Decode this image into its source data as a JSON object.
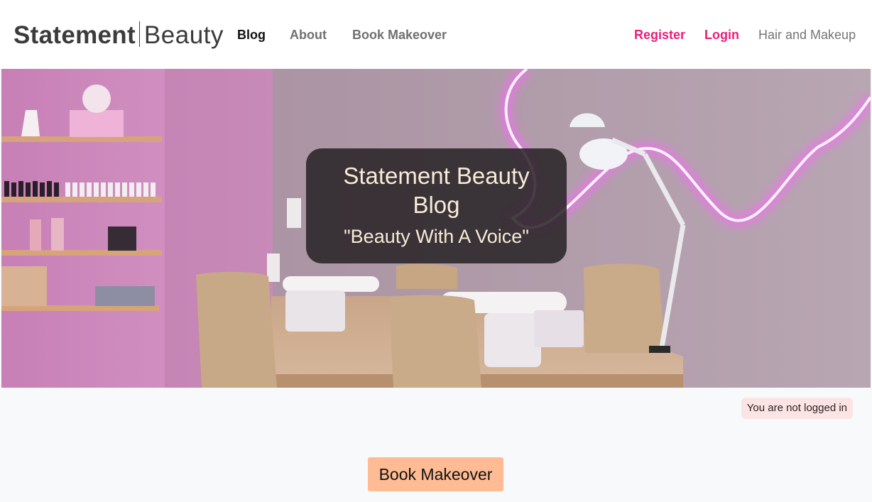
{
  "brand": {
    "strong": "Statement",
    "light": "Beauty"
  },
  "nav": {
    "blog": "Blog",
    "about": "About",
    "book_makeover": "Book Makeover",
    "register": "Register",
    "login": "Login",
    "category": "Hair and Makeup"
  },
  "hero": {
    "title": "Statement Beauty Blog",
    "tagline": "\"Beauty With A Voice\"",
    "image": "nail-salon-photo"
  },
  "status": {
    "login_text": "You are not logged in"
  },
  "cta": {
    "book_label": "Book Makeover"
  },
  "colors": {
    "accent": "#e91e7a",
    "button": "#ffbb94",
    "status_bg": "#fde4e4",
    "page_bg": "#f8f9fa"
  }
}
